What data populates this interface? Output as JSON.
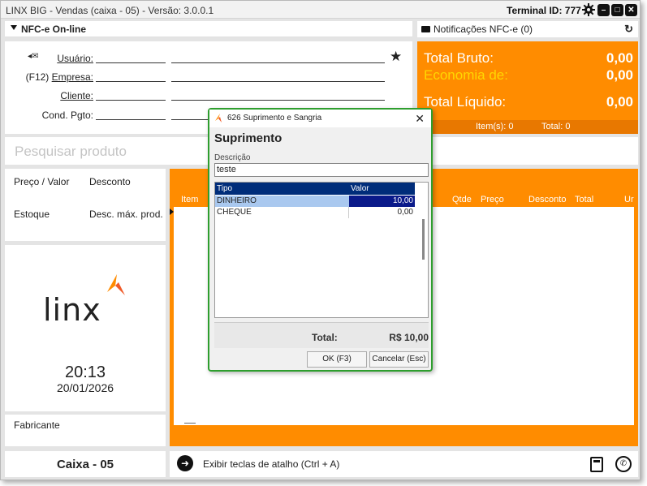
{
  "window": {
    "title": "LINX BIG - Vendas (caixa - 05) - Versão: 3.0.0.1",
    "terminal": "Terminal ID: 777"
  },
  "nfce": {
    "label": "NFC-e On-line"
  },
  "notifications": {
    "label": "Notificações NFC-e (0)"
  },
  "form": {
    "usuario": "Usuário:",
    "empresa_key": "(F12)",
    "empresa": "Empresa:",
    "cliente": "Cliente:",
    "cond_pgto": "Cond. Pgto:"
  },
  "totals": {
    "bruto_label": "Total Bruto:",
    "bruto_value": "0,00",
    "economia_label": "Economia de:",
    "economia_value": "0,00",
    "liquido_label": "Total Líquido:",
    "liquido_value": "0,00",
    "items": "Item(s): 0",
    "total": "Total: 0"
  },
  "search": {
    "placeholder": "Pesquisar produto"
  },
  "price_panel": {
    "preco_valor": "Preço / Valor",
    "desconto": "Desconto",
    "estoque": "Estoque",
    "desc_max": "Desc. máx. prod."
  },
  "brand": {
    "logo_text": "LINX"
  },
  "clock": {
    "time": "20:13",
    "date": "20/01/2026"
  },
  "fabricante": "Fabricante",
  "caixa": "Caixa - 05",
  "grid": {
    "columns": [
      "Item",
      "Qtde",
      "Preço",
      "Desconto",
      "Total",
      "Ur"
    ]
  },
  "shortcuts": {
    "label": "Exibir teclas de atalho (Ctrl + A)"
  },
  "dialog": {
    "title": "626 Suprimento e Sangria",
    "heading": "Suprimento",
    "desc_label": "Descrição",
    "desc_value": "teste",
    "col_tipo": "Tipo",
    "col_valor": "Valor",
    "rows": [
      {
        "tipo": "DINHEIRO",
        "valor": "10,00"
      },
      {
        "tipo": "CHEQUE",
        "valor": "0,00"
      }
    ],
    "total_label": "Total:",
    "total_value": "R$ 10,00",
    "ok_label": "OK (F3)",
    "cancel_label": "Cancelar (Esc)"
  },
  "colors": {
    "accent": "#ff8c00",
    "economia": "#ffd700",
    "dialog_border": "#2e9e2e",
    "table_header": "#002d7a"
  }
}
